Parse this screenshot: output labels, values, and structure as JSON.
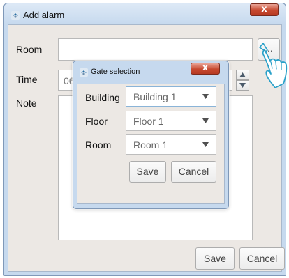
{
  "window": {
    "title": "Add alarm",
    "close_label": "x",
    "room_label": "Room",
    "room_value": "",
    "browse_label": "...",
    "time_label": "Time",
    "time_value": "06",
    "note_label": "Note",
    "note_value": "",
    "save_label": "Save",
    "cancel_label": "Cancel"
  },
  "dialog": {
    "title": "Gate selection",
    "close_label": "x",
    "fields": [
      {
        "label": "Building",
        "value": "Building 1"
      },
      {
        "label": "Floor",
        "value": "Floor 1"
      },
      {
        "label": "Room",
        "value": "Room 1"
      }
    ],
    "save_label": "Save",
    "cancel_label": "Cancel"
  },
  "colors": {
    "title_bar": "#c6d9ee",
    "client_bg": "#ece8e4",
    "close_button": "#c7492f",
    "focus_border": "#8ab4d8",
    "hand_outline": "#2aa1c9"
  },
  "icons": {
    "window_icon": "app-icon",
    "close": "close-icon",
    "spin_up": "triangle-up-icon",
    "spin_down": "triangle-down-icon",
    "combo": "triangle-down-icon",
    "pointer": "tap-hand-icon"
  }
}
